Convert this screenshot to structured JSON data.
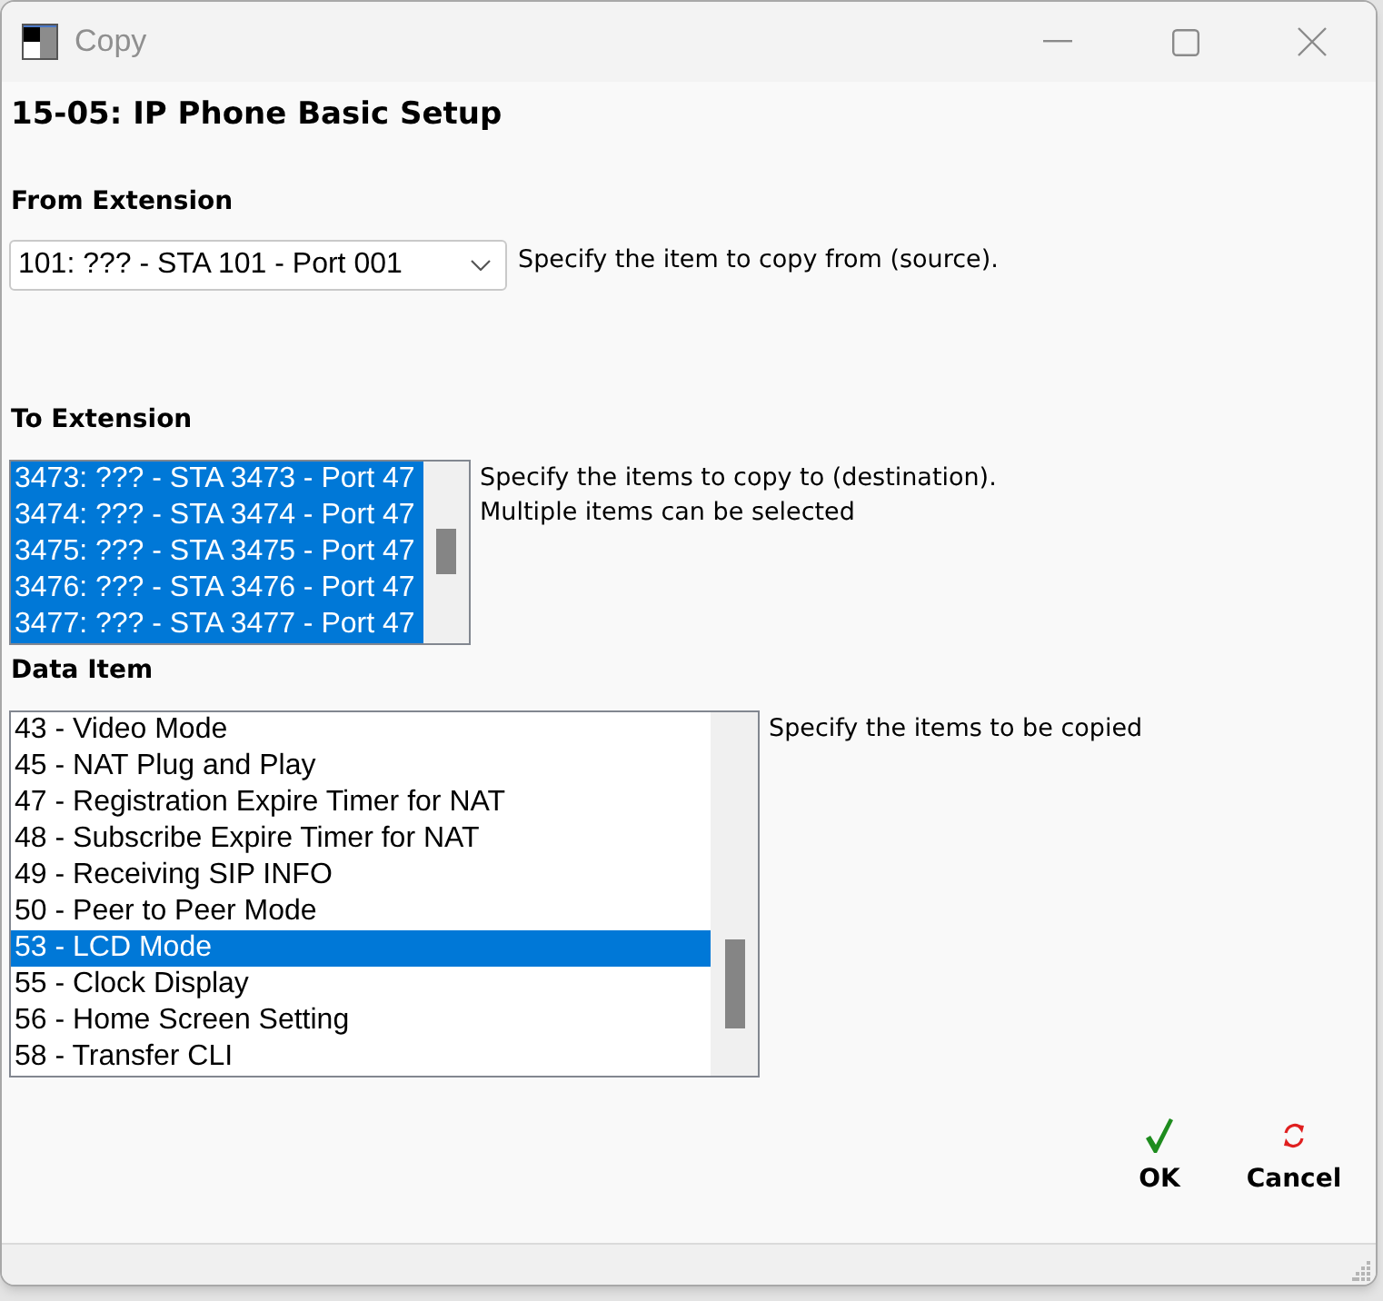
{
  "window": {
    "title": "Copy"
  },
  "heading": "15-05: IP Phone Basic Setup",
  "from_extension": {
    "label": "From Extension",
    "value": "101: ??? - STA 101 - Port 001",
    "hint": "Specify the item to copy from (source)."
  },
  "to_extension": {
    "label": "To Extension",
    "items": [
      {
        "text": "3473: ??? - STA 3473 - Port 47",
        "selected": true
      },
      {
        "text": "3474: ??? - STA 3474 - Port 47",
        "selected": true
      },
      {
        "text": "3475: ??? - STA 3475 - Port 47",
        "selected": true
      },
      {
        "text": "3476: ??? - STA 3476 - Port 47",
        "selected": true
      },
      {
        "text": "3477: ??? - STA 3477 - Port 47",
        "selected": true
      }
    ],
    "hint": [
      "Specify the items to copy to (destination).",
      "Multiple items can be selected"
    ]
  },
  "data_item": {
    "label": "Data Item",
    "items": [
      {
        "text": "43 - Video Mode",
        "selected": false
      },
      {
        "text": "45 - NAT Plug and Play",
        "selected": false
      },
      {
        "text": "47 - Registration Expire Timer for NAT",
        "selected": false
      },
      {
        "text": "48 - Subscribe Expire Timer for NAT",
        "selected": false
      },
      {
        "text": "49 - Receiving SIP INFO",
        "selected": false
      },
      {
        "text": "50 - Peer to Peer Mode",
        "selected": false
      },
      {
        "text": "53 - LCD Mode",
        "selected": true
      },
      {
        "text": "55 - Clock Display",
        "selected": false
      },
      {
        "text": "56 - Home Screen Setting",
        "selected": false
      },
      {
        "text": "58 - Transfer CLI",
        "selected": false
      }
    ],
    "hint": "Specify the items to be copied"
  },
  "buttons": [
    {
      "kind": "ok",
      "label": "OK"
    },
    {
      "kind": "cancel",
      "label": "Cancel"
    }
  ]
}
